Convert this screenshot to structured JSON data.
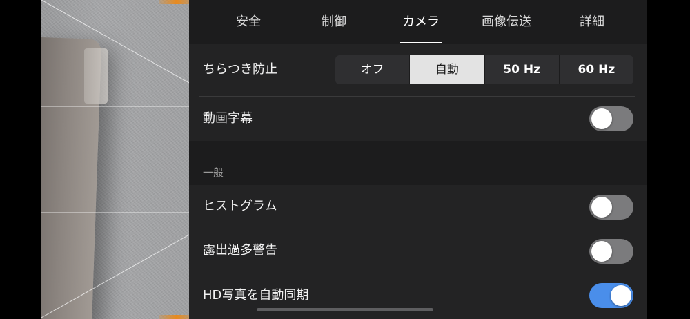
{
  "tabs": [
    {
      "label": "安全"
    },
    {
      "label": "制御"
    },
    {
      "label": "カメラ"
    },
    {
      "label": "画像伝送"
    },
    {
      "label": "詳細"
    }
  ],
  "active_tab": "カメラ",
  "camera": {
    "anti_flicker": {
      "label": "ちらつき防止",
      "options": [
        "オフ",
        "自動",
        "50 Hz",
        "60 Hz"
      ],
      "selected": "自動"
    },
    "video_subtitles": {
      "label": "動画字幕",
      "enabled": false
    }
  },
  "general": {
    "section_title": "一般",
    "histogram": {
      "label": "ヒストグラム",
      "enabled": false
    },
    "overexposure_warning": {
      "label": "露出過多警告",
      "enabled": false
    },
    "hd_photo_sync": {
      "label": "HD写真を自動同期",
      "enabled": true
    }
  },
  "colors": {
    "accent": "#4a8eea",
    "toggle_off": "#7b7b7d",
    "panel_bg": "#1c1c1d",
    "row_bg": "#232324",
    "preview_marker": "#e88a1e"
  }
}
